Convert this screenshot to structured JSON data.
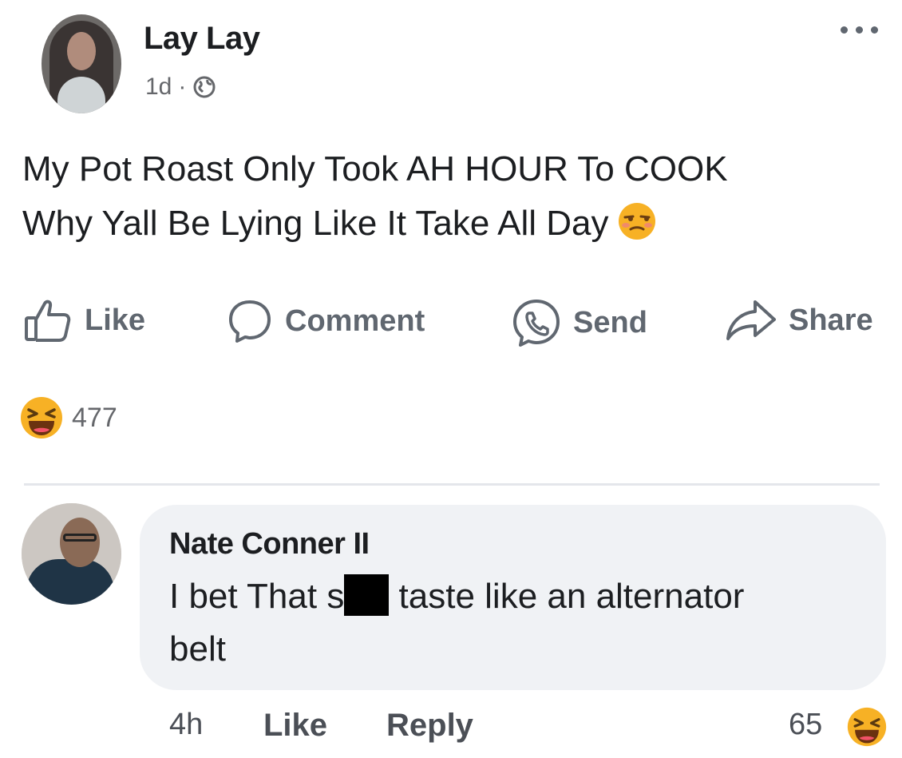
{
  "post": {
    "author": "Lay Lay",
    "time": "1d",
    "separator": "·",
    "privacy_icon": "globe-icon",
    "text_line1": "My Pot Roast Only Took AH HOUR To COOK",
    "text_line2": "Why Yall Be Lying Like It Take All Day",
    "text_emoji": "unamused-face-icon"
  },
  "actions": {
    "like": "Like",
    "comment": "Comment",
    "send": "Send",
    "share": "Share"
  },
  "reactions": {
    "emoji": "haha-icon",
    "count": "477"
  },
  "comment": {
    "author": "Nate Conner II",
    "text_before": "I bet That s",
    "text_after": " taste like an alternator",
    "text_line2": "belt",
    "time": "4h",
    "like": "Like",
    "reply": "Reply",
    "reaction_count": "65",
    "reaction_emoji": "haha-icon"
  },
  "colors": {
    "text": "#1c1e21",
    "secondary": "#65676b",
    "bubble": "#f0f2f5",
    "emoji_yellow": "#f7b125"
  }
}
